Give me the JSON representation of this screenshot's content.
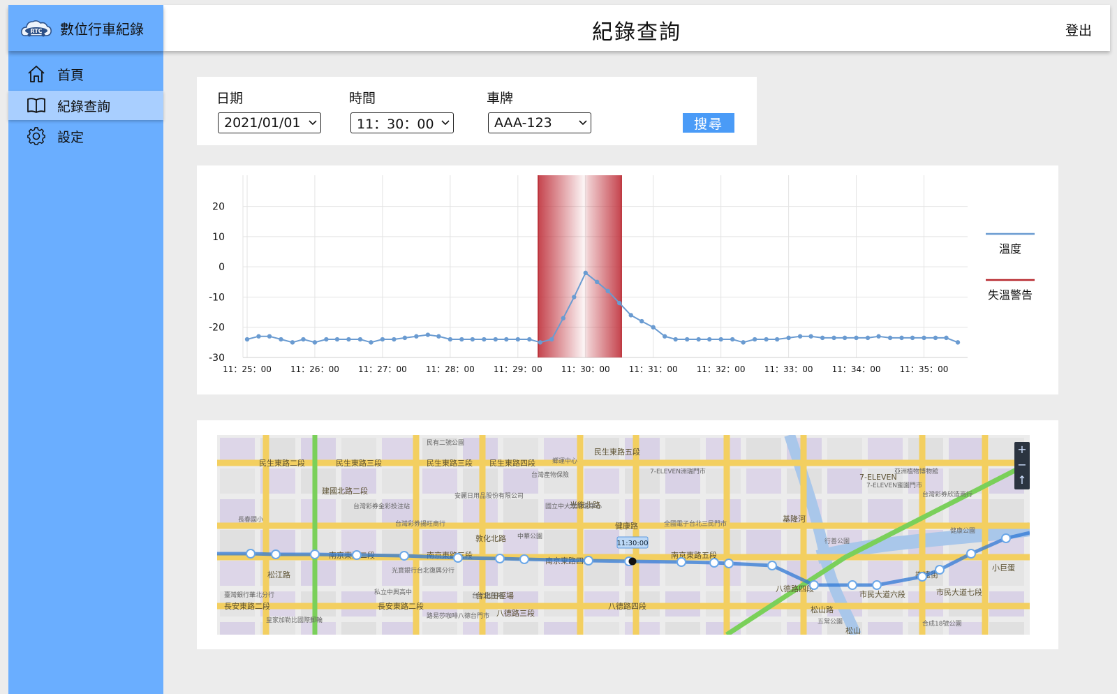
{
  "app": {
    "brand_name": "數位行車紀錄",
    "logo_text": "RTC"
  },
  "header": {
    "title": "紀錄查詢",
    "logout_label": "登出"
  },
  "sidebar": {
    "items": [
      {
        "label": "首頁",
        "icon": "home-icon",
        "active": false
      },
      {
        "label": "紀錄查詢",
        "icon": "book-icon",
        "active": true
      },
      {
        "label": "設定",
        "icon": "gear-icon",
        "active": false
      }
    ]
  },
  "filter": {
    "date_label": "日期",
    "date_value": "2021/01/01",
    "time_label": "時間",
    "time_value": "11：30：00",
    "plate_label": "車牌",
    "plate_value": "AAA-123",
    "search_label": "搜尋"
  },
  "chart_data": {
    "type": "line",
    "y_ticks": [
      20,
      10,
      0,
      -10,
      -20,
      -30
    ],
    "ylim": [
      -30,
      25
    ],
    "x_tick_labels": [
      "11：25：00",
      "11：26：00",
      "11：27：00",
      "11：28：00",
      "11：29：00",
      "11：30：00",
      "11：31：00",
      "11：32：00",
      "11：33：00",
      "11：34：00",
      "11：35：00"
    ],
    "xlim_minutes": [
      0,
      10.5
    ],
    "series": [
      {
        "name": "溫度",
        "color": "#6a9bd1",
        "points": [
          [
            0.0,
            -24
          ],
          [
            0.17,
            -23
          ],
          [
            0.33,
            -23
          ],
          [
            0.5,
            -24
          ],
          [
            0.67,
            -25
          ],
          [
            0.83,
            -24
          ],
          [
            1.0,
            -25
          ],
          [
            1.17,
            -24
          ],
          [
            1.33,
            -24
          ],
          [
            1.5,
            -24
          ],
          [
            1.67,
            -24
          ],
          [
            1.83,
            -25
          ],
          [
            2.0,
            -24
          ],
          [
            2.17,
            -24
          ],
          [
            2.33,
            -23.5
          ],
          [
            2.5,
            -23
          ],
          [
            2.67,
            -22.5
          ],
          [
            2.83,
            -23
          ],
          [
            3.0,
            -24
          ],
          [
            3.17,
            -24
          ],
          [
            3.33,
            -24
          ],
          [
            3.5,
            -24
          ],
          [
            3.67,
            -24
          ],
          [
            3.83,
            -24
          ],
          [
            4.0,
            -24
          ],
          [
            4.17,
            -24
          ],
          [
            4.33,
            -25
          ],
          [
            4.5,
            -24
          ],
          [
            4.67,
            -17
          ],
          [
            4.83,
            -10
          ],
          [
            5.0,
            -2
          ],
          [
            5.17,
            -5
          ],
          [
            5.33,
            -8
          ],
          [
            5.5,
            -12
          ],
          [
            5.67,
            -16
          ],
          [
            5.83,
            -18
          ],
          [
            6.0,
            -20
          ],
          [
            6.17,
            -23
          ],
          [
            6.33,
            -24
          ],
          [
            6.5,
            -24
          ],
          [
            6.67,
            -24
          ],
          [
            6.83,
            -24
          ],
          [
            7.0,
            -24
          ],
          [
            7.17,
            -24
          ],
          [
            7.33,
            -25
          ],
          [
            7.5,
            -24
          ],
          [
            7.67,
            -24
          ],
          [
            7.83,
            -24
          ],
          [
            8.0,
            -23.5
          ],
          [
            8.17,
            -23
          ],
          [
            8.33,
            -23
          ],
          [
            8.5,
            -23.5
          ],
          [
            8.67,
            -23.5
          ],
          [
            8.83,
            -23.5
          ],
          [
            9.0,
            -23.5
          ],
          [
            9.17,
            -23.5
          ],
          [
            9.33,
            -23
          ],
          [
            9.5,
            -23.5
          ],
          [
            9.67,
            -23.5
          ],
          [
            9.83,
            -23.5
          ],
          [
            10.0,
            -23.5
          ],
          [
            10.17,
            -23.5
          ],
          [
            10.33,
            -23.5
          ],
          [
            10.5,
            -25
          ]
        ]
      }
    ],
    "alert_band": {
      "name": "失溫警告",
      "color": "#b7282e",
      "x_range_minutes": [
        4.3,
        5.53
      ]
    },
    "legend": [
      {
        "label": "溫度",
        "color": "#6a9bd1"
      },
      {
        "label": "失溫警告",
        "color": "#b7282e"
      }
    ],
    "legend_position": "right",
    "grid": true
  },
  "map": {
    "marker_time_label": "11:30:00",
    "zoom_in_label": "+",
    "zoom_out_label": "−",
    "compass_label": "↑",
    "street_labels": [
      "民生東路二段",
      "民生東路三段",
      "民生東路三段",
      "民生東路四段",
      "民生東路五段",
      "南京東路二段",
      "南京東路三段",
      "南京東路四段",
      "南京東路五段",
      "長安東路二段",
      "長安東路二段",
      "八德路三段",
      "八德路四段",
      "健康路",
      "敦化北路",
      "光復北路",
      "建國北路二段",
      "松江路",
      "基隆河",
      "八德路四段",
      "市民大道六段",
      "市民大道七段",
      "撫遠街",
      "松山路",
      "7-ELEVEN",
      "台北田徑場",
      "小巨蛋",
      "松山"
    ],
    "poi_labels": [
      "台灣彩券金彩投注站",
      "台灣彩券揚旺商行",
      "臺灣銀行華北分行",
      "皇家加勒比國際郵輪",
      "私立中興高中",
      "安麗日用品股份有限公司",
      "國立中大學附北中心",
      "中華公園",
      "全國電子台北三民門市",
      "光寶銀行台北復興分行",
      "台北田徑場",
      "路易莎咖啡八德台門市",
      "行善公園",
      "台灣彩券欣造商行",
      "亞洲植物博物館",
      "五常公園",
      "合成18號公園",
      "7-ELEVEN蜜園門市",
      "7-ELEVEN洲瑞門市",
      "台灣產物保險",
      "鄉運中心",
      "健康公園",
      "長春國小",
      "民有二號公園"
    ]
  }
}
